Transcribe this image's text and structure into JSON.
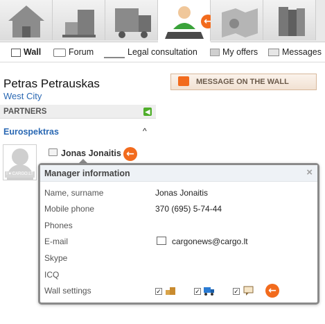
{
  "top_tabs": [
    {
      "name": "home",
      "icon": "house-icon",
      "active": false
    },
    {
      "name": "cargo",
      "icon": "boxes-icon",
      "active": false
    },
    {
      "name": "transport",
      "icon": "truck-icon",
      "active": false
    },
    {
      "name": "manager",
      "icon": "manager-user-icon",
      "active": true
    },
    {
      "name": "map",
      "icon": "map-icon",
      "active": false
    },
    {
      "name": "catalog",
      "icon": "books-icon",
      "active": false
    }
  ],
  "subnav": {
    "wall": "Wall",
    "forum": "Forum",
    "legal": "Legal consultation",
    "offers": "My offers",
    "messages": "Messages"
  },
  "profile": {
    "name": "Petras Petrauskas",
    "city": "West City"
  },
  "message_button": "MESSAGE ON THE WALL",
  "partners": {
    "heading": "PARTNERS",
    "company": "Eurospektras",
    "contact_name": "Jonas Jonaitis",
    "avatar_logo": "I ♥ CARGO.LT"
  },
  "popup": {
    "title": "Manager information",
    "close": "×",
    "labels": {
      "name": "Name, surname",
      "mobile": "Mobile phone",
      "phones": "Phones",
      "email": "E-mail",
      "skype": "Skype",
      "icq": "ICQ",
      "wall": "Wall settings"
    },
    "values": {
      "name": "Jonas Jonaitis",
      "mobile": "370 (695) 5-74-44",
      "email": "cargonews@cargo.lt"
    },
    "wall_settings": [
      {
        "icon": "cargo-boxes-icon",
        "checked": true
      },
      {
        "icon": "truck-icon",
        "checked": true
      },
      {
        "icon": "speech-bubble-icon",
        "checked": true
      }
    ]
  },
  "colors": {
    "accent_orange": "#f26b1d",
    "link_blue": "#2a68b3",
    "green": "#4fae2a"
  }
}
